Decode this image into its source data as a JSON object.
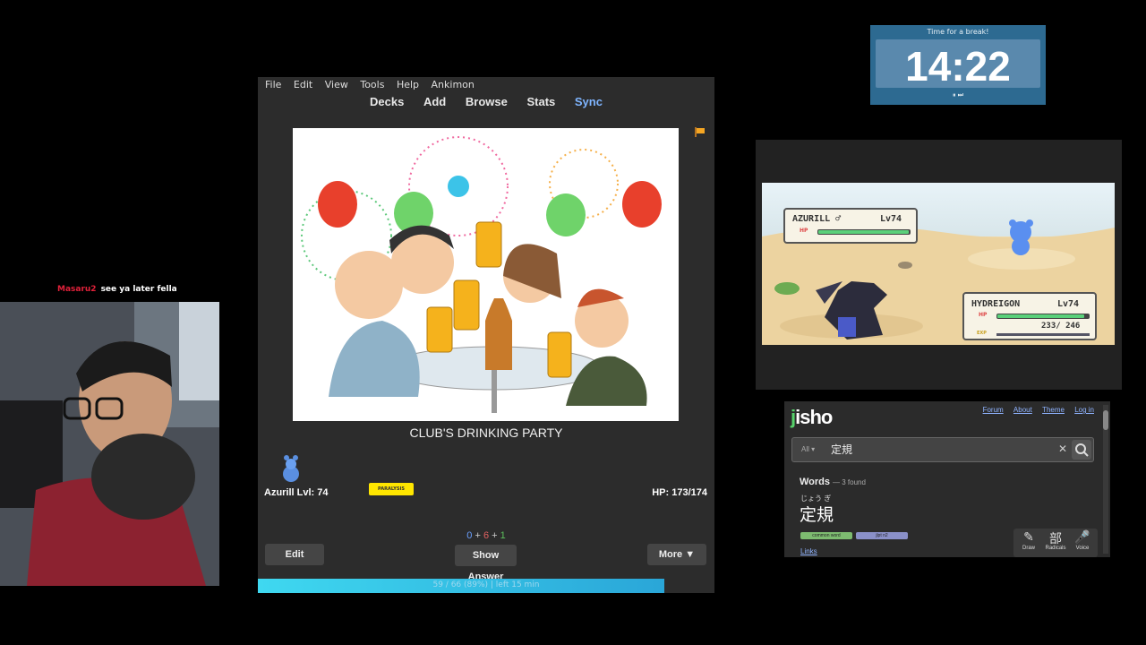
{
  "chat": {
    "user": "Masaru2",
    "message": "see ya later fella"
  },
  "anki": {
    "menu": [
      "File",
      "Edit",
      "View",
      "Tools",
      "Help",
      "Ankimon"
    ],
    "toolbar": [
      "Decks",
      "Add",
      "Browse",
      "Stats",
      "Sync"
    ],
    "card_text": "CLUB'S DRINKING PARTY",
    "pokemon_label": "Azurill Lvl: 74",
    "status_badge": "PARALYSIS",
    "hp_text": "HP: 173/174",
    "counts": {
      "new": "0",
      "plus1": "+",
      "learning": "6",
      "plus2": "+",
      "review": "1"
    },
    "buttons": {
      "edit": "Edit",
      "show_answer": "Show Answer",
      "more": "More ▼"
    },
    "progress_text": "59 / 66 (89%) | left 15 min",
    "progress_fraction": 0.89
  },
  "timer": {
    "title": "Time for a break!",
    "value": "14:22",
    "controls": "⏸ ⏭"
  },
  "game": {
    "enemy_name": "AZURILL ♂",
    "enemy_level": "Lv74",
    "player_name": "HYDREIGON",
    "player_level": "Lv74",
    "player_hp": "233/ 246",
    "enemy_hp_fraction": 0.99,
    "player_hp_fraction": 0.95,
    "hp_label": "HP",
    "exp_label": "EXP"
  },
  "jisho": {
    "logo": "jisho",
    "nav": [
      "Forum",
      "About",
      "Theme",
      "Log in"
    ],
    "search_scope": "All ▾",
    "query": "定規",
    "results_title": "Words",
    "results_count": "— 3 found",
    "furigana": "じょう ぎ",
    "word": "定規",
    "tags": [
      "common word",
      "jlpt n2"
    ],
    "links": "Links",
    "tools": [
      "Draw",
      "Radicals",
      "Voice"
    ],
    "tool_glyphs": [
      "✎",
      "部",
      "🎤"
    ]
  }
}
